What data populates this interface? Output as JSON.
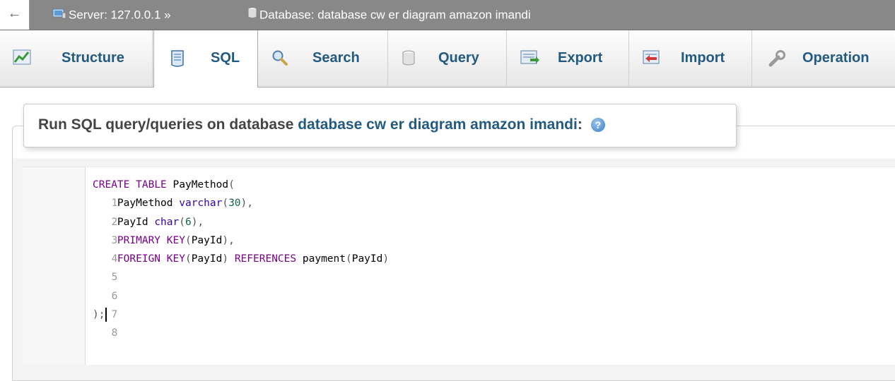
{
  "breadcrumb": {
    "server": "Server: 127.0.0.1 »",
    "database": "Database: database cw er diagram amazon imandi"
  },
  "tabs": [
    {
      "label": "Structure",
      "icon": "structure-icon"
    },
    {
      "label": "SQL",
      "icon": "sql-icon",
      "active": true
    },
    {
      "label": "Search",
      "icon": "search-icon"
    },
    {
      "label": "Query",
      "icon": "query-icon"
    },
    {
      "label": "Export",
      "icon": "export-icon"
    },
    {
      "label": "Import",
      "icon": "import-icon"
    },
    {
      "label": "Operation",
      "icon": "wrench-icon"
    }
  ],
  "panel": {
    "title_prefix": "Run SQL query/queries on database ",
    "db_name": "database cw er diagram amazon imandi",
    "title_suffix": ":"
  },
  "editor": {
    "line_numbers": [
      "1",
      "2",
      "3",
      "4",
      "5",
      "6",
      "7",
      "8"
    ],
    "code_text": "CREATE TABLE PayMethod(\n    PayMethod varchar(30),\n    PayId char(6),\n    PRIMARY KEY(PayId),\n    FOREIGN KEY(PayId) REFERENCES payment(PayId)\n\n\n);"
  },
  "colors": {
    "link_blue": "#235a81",
    "keyword_purple": "#770088",
    "type_purple": "#3300aa",
    "number_green": "#116644",
    "topbar_gray": "#888888"
  }
}
